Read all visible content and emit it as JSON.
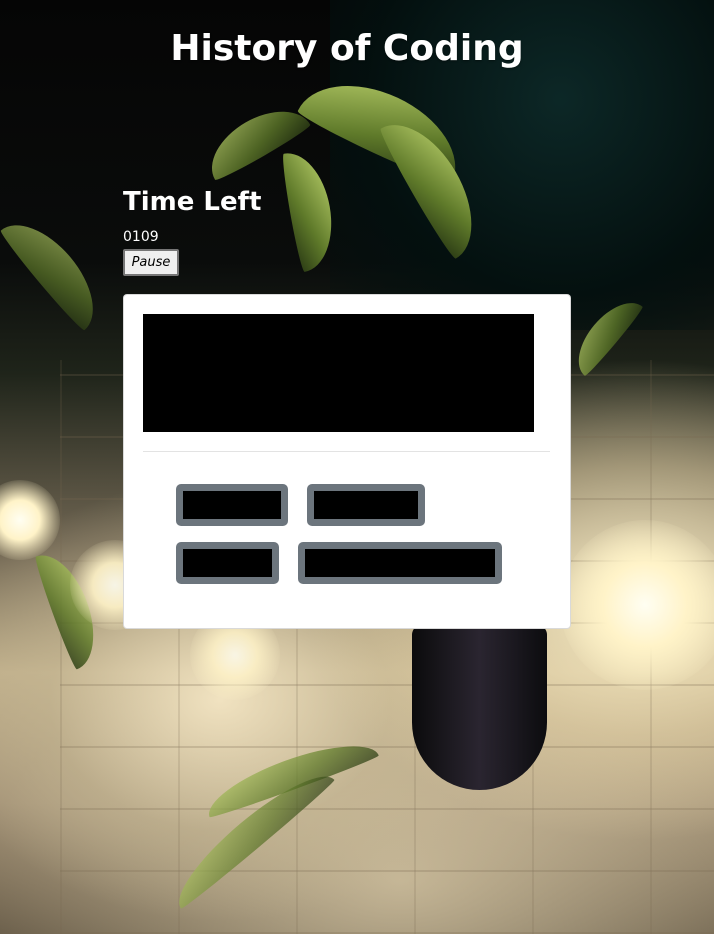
{
  "page": {
    "title": "History of Coding"
  },
  "timer": {
    "heading": "Time Left",
    "value": "0109",
    "pause_label": "Pause"
  },
  "quiz": {
    "question": "",
    "answers": [
      {
        "label": ""
      },
      {
        "label": ""
      },
      {
        "label": ""
      },
      {
        "label": ""
      }
    ]
  },
  "colors": {
    "card_background": "#ffffff",
    "question_fill": "#000000",
    "answer_fill": "#000000",
    "answer_border": "#6c757d",
    "title_text": "#ffffff"
  }
}
